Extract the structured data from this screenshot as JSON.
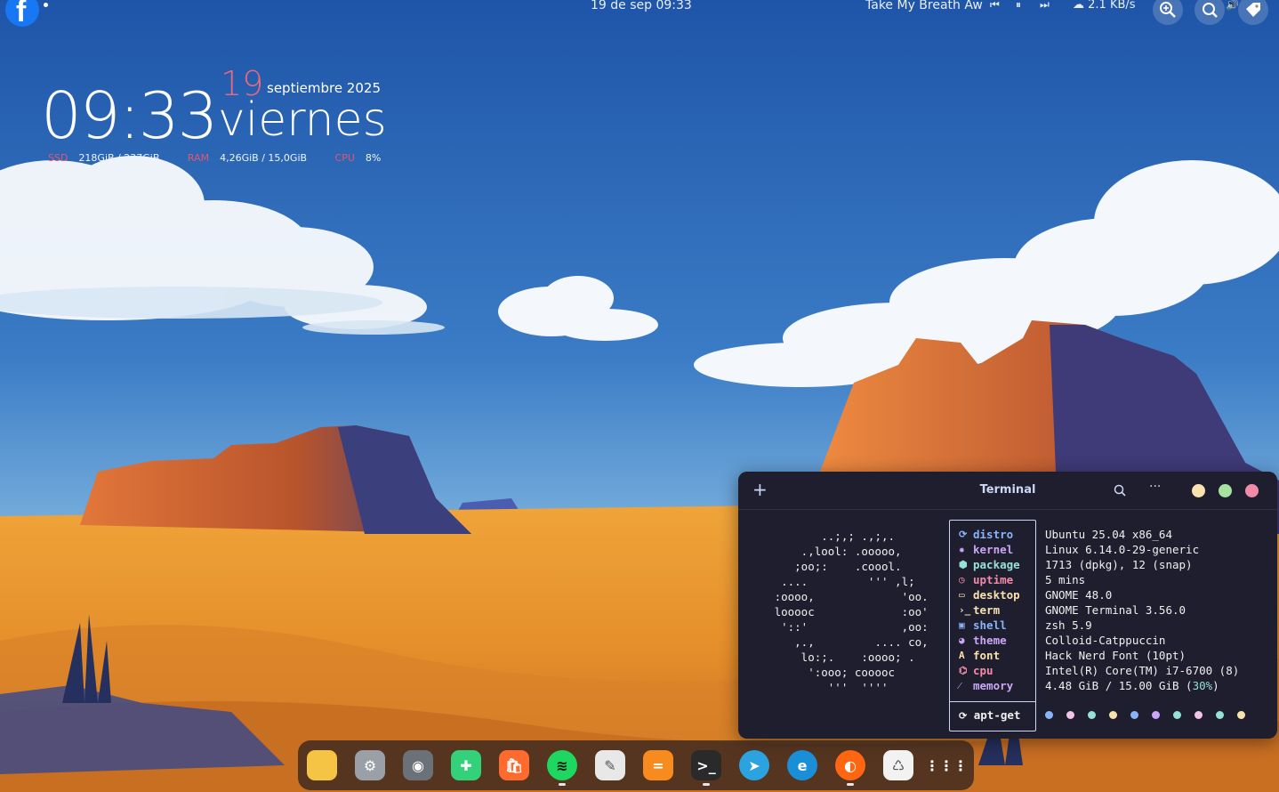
{
  "topbar": {
    "clock": "19 de sep  09:33",
    "media_title": "Take My Breath Aw",
    "net_speed": "2.1 KB/s"
  },
  "widget": {
    "time": "09:33",
    "day_number": "19",
    "month_year": "septiembre 2025",
    "weekday": "viernes",
    "stats": [
      {
        "label": "SSD",
        "value": "218GiB / 237GiB"
      },
      {
        "label": "RAM",
        "value": "4,26GiB / 15,0GiB"
      },
      {
        "label": "CPU",
        "value": "8%"
      }
    ]
  },
  "terminal": {
    "title": "Terminal",
    "ascii_logo": "          ..;,; .,;,.\n       .,lool: .ooooo,\n      ;oo;:    .coool.\n    ....         ''' ,l;\n   :oooo,             'oo.\n   looooc             :oo'\n    '::'              ,oo:\n      ,.,         .... co,\n       lo:;.    :oooo; .\n        ':ooo; cooooc\n           '''  ''''",
    "info": [
      {
        "key": "distro",
        "value": "Ubuntu 25.04 x86_64",
        "color": "#89b4fa",
        "icon": "ubuntu-icon"
      },
      {
        "key": "kernel",
        "value": "Linux 6.14.0-29-generic",
        "color": "#cba6f7",
        "icon": "gear-icon"
      },
      {
        "key": "package",
        "value": "1713 (dpkg), 12 (snap)",
        "color": "#94e2d5",
        "icon": "package-icon"
      },
      {
        "key": "uptime",
        "value": "5 mins",
        "color": "#f38ba8",
        "icon": "clock-icon"
      },
      {
        "key": "desktop",
        "value": "GNOME 48.0",
        "color": "#f9e2af",
        "icon": "monitor-icon"
      },
      {
        "key": "term",
        "value": "GNOME Terminal 3.56.0",
        "color": "#f9e2af",
        "icon": "prompt-icon"
      },
      {
        "key": "shell",
        "value": "zsh 5.9",
        "color": "#89b4fa",
        "icon": "shell-icon"
      },
      {
        "key": "theme",
        "value": "Colloid-Catppuccin",
        "color": "#cba6f7",
        "icon": "palette-icon"
      },
      {
        "key": "font",
        "value": "Hack Nerd Font (10pt)",
        "color": "#f9e2af",
        "icon": "font-icon"
      },
      {
        "key": "cpu",
        "value": "Intel(R) Core(TM) i7-6700 (8)",
        "color": "#f38ba8",
        "icon": "chip-icon"
      },
      {
        "key": "memory",
        "value": "4.48 GiB / 15.00 GiB (30%)",
        "color": "#cba6f7",
        "icon": "memory-icon"
      }
    ],
    "memory_pct_text": "30%",
    "footer_label": "apt-get",
    "palette_colors": [
      "#89b4fa",
      "#f5c2e7",
      "#94e2d5",
      "#f9e2af",
      "#89b4fa",
      "#cba6f7",
      "#94e2d5",
      "#f5c2e7",
      "#94e2d5",
      "#f9e2af"
    ]
  },
  "dock": {
    "apps": [
      {
        "name": "files",
        "color": "#f6c445"
      },
      {
        "name": "settings",
        "color": "#9aa0a8"
      },
      {
        "name": "toggle",
        "color": "#6b7178"
      },
      {
        "name": "extensions",
        "color": "#33d17a"
      },
      {
        "name": "shop",
        "color": "#ff6a2f"
      },
      {
        "name": "spotify",
        "color": "#1ed760"
      },
      {
        "name": "text-editor",
        "color": "#e8e8e8"
      },
      {
        "name": "equalizer",
        "color": "#f78b1e"
      },
      {
        "name": "terminal",
        "color": "#2a2a2a"
      },
      {
        "name": "telegram",
        "color": "#2aa3e0"
      },
      {
        "name": "edge",
        "color": "#1a8fd8"
      },
      {
        "name": "firefox",
        "color": "#ff6611"
      },
      {
        "name": "trash",
        "color": "#f2f2f2"
      },
      {
        "name": "app-grid",
        "color": "#ffffff"
      }
    ]
  }
}
